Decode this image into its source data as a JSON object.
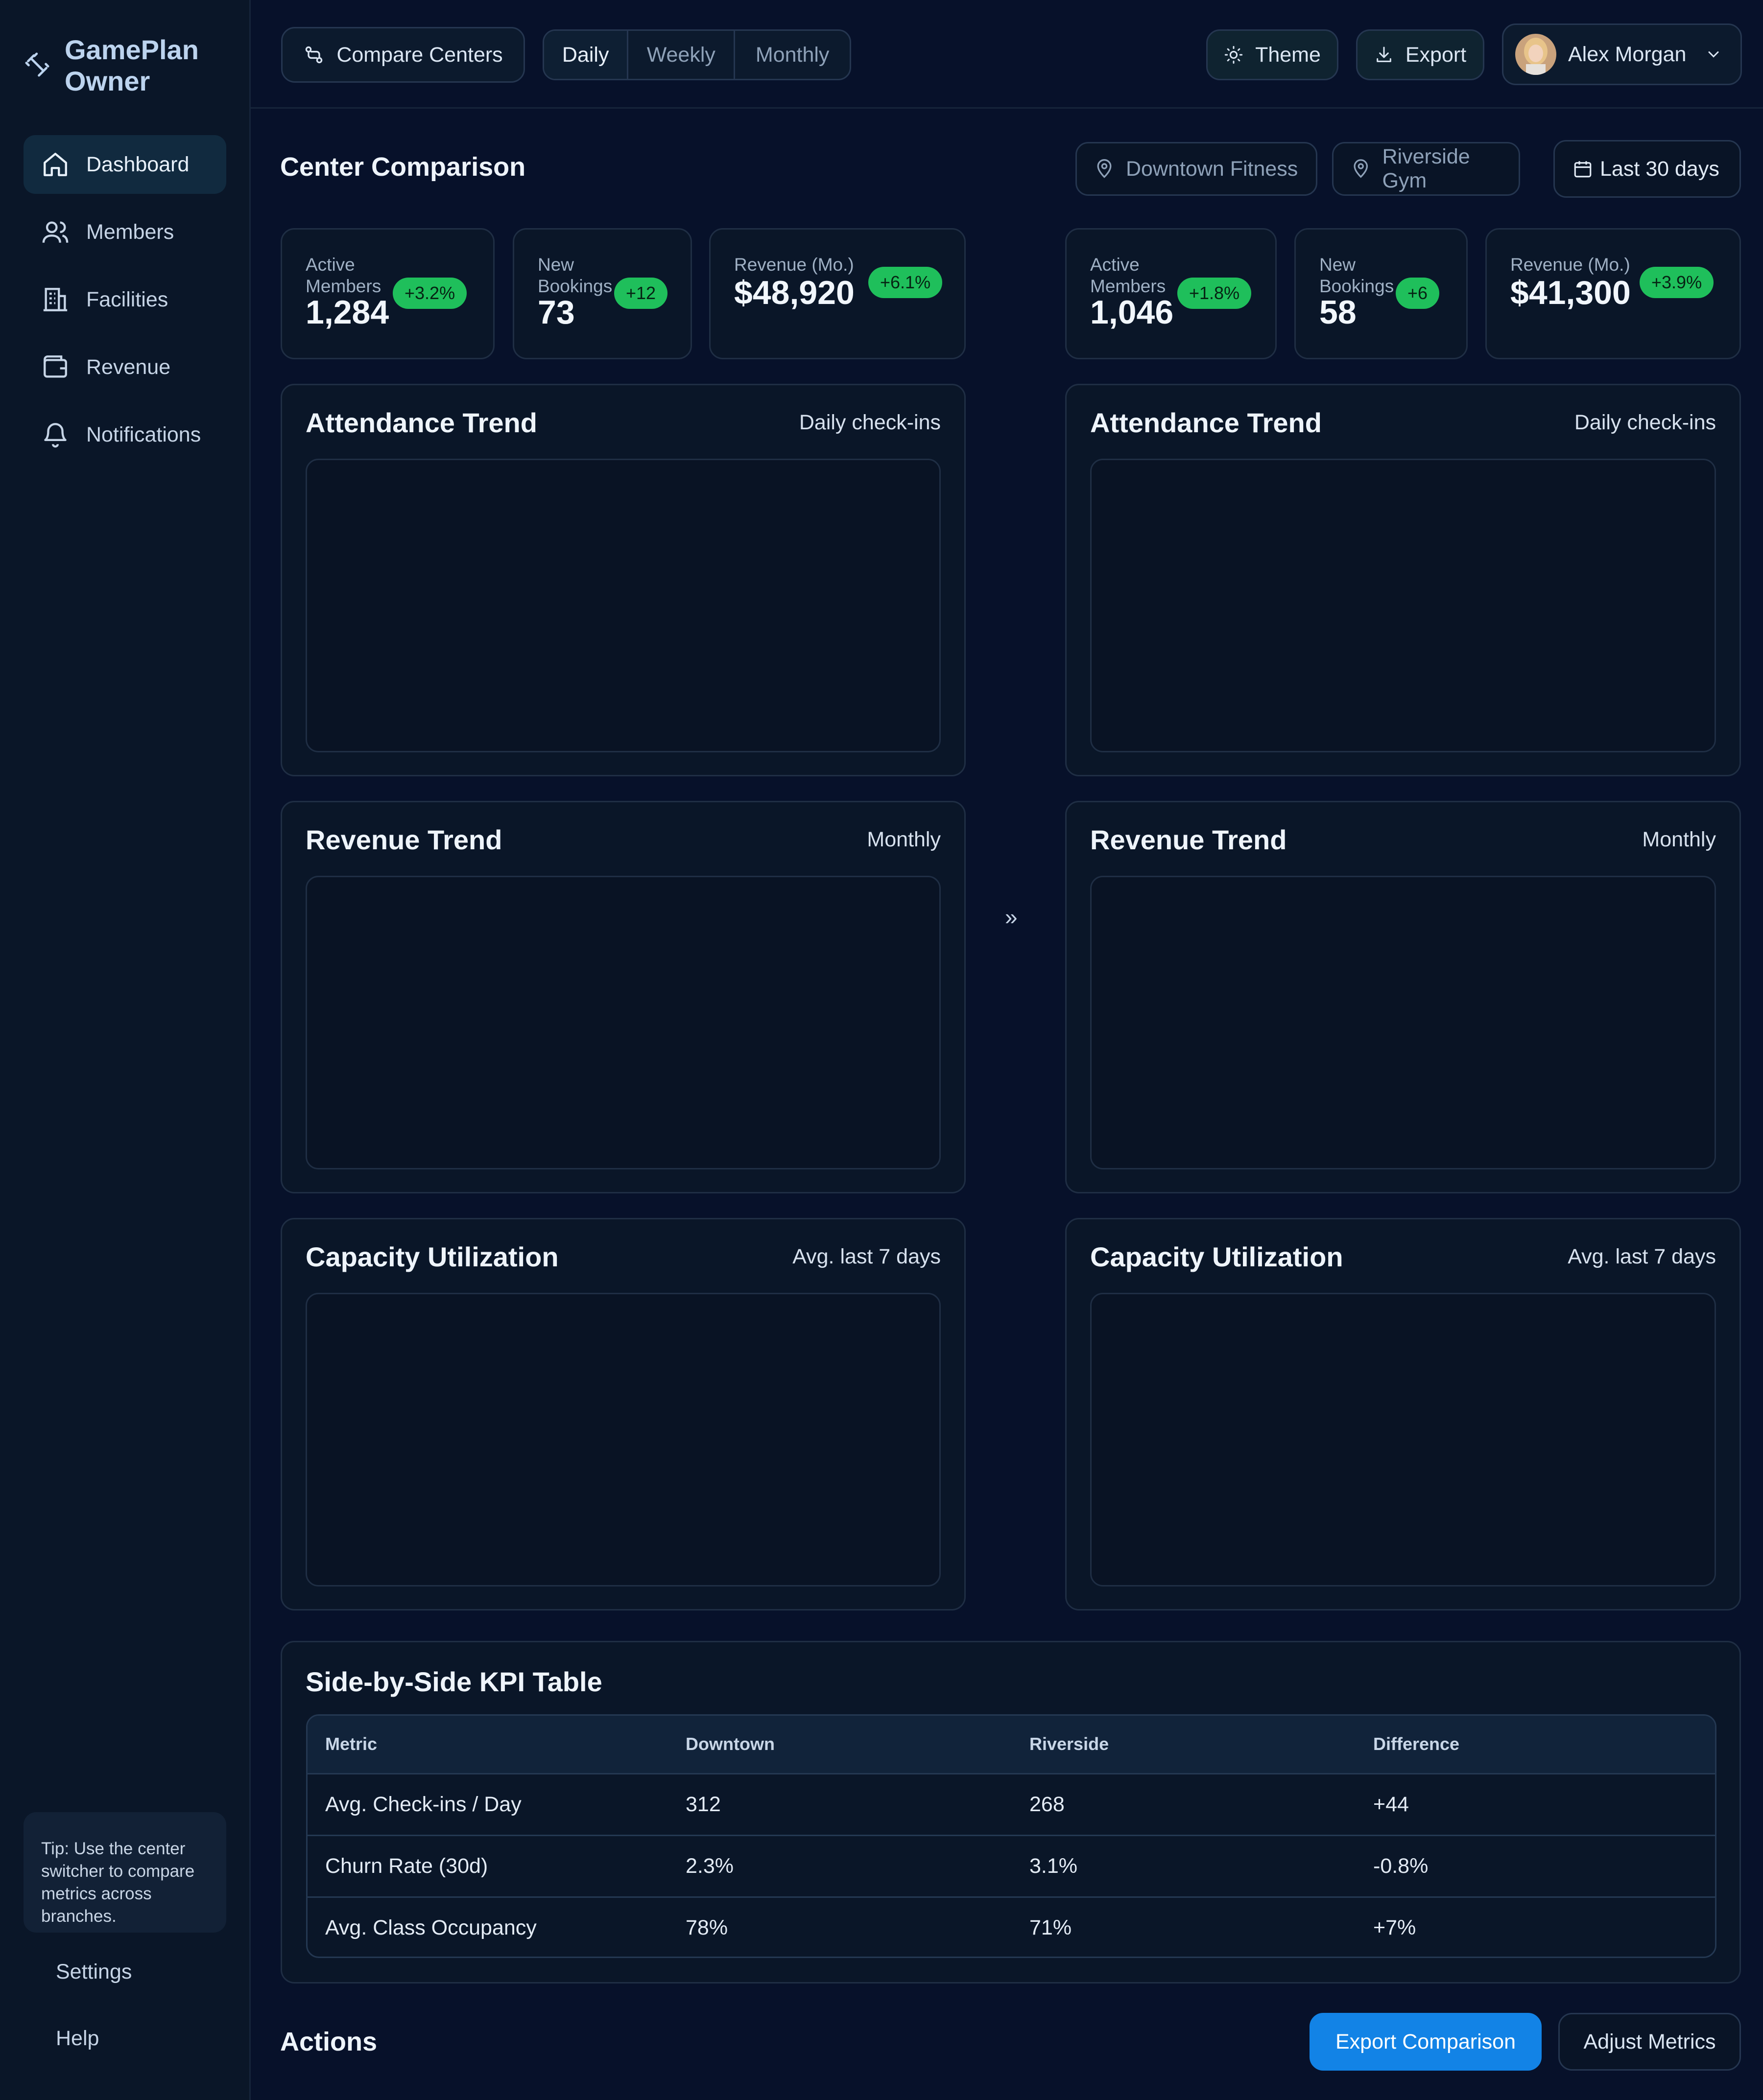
{
  "brand": {
    "line1": "GamePlan",
    "line2": "Owner"
  },
  "nav": [
    {
      "label": "Dashboard",
      "icon": "home-icon",
      "active": true
    },
    {
      "label": "Members",
      "icon": "users-icon"
    },
    {
      "label": "Facilities",
      "icon": "building-icon"
    },
    {
      "label": "Revenue",
      "icon": "wallet-icon"
    },
    {
      "label": "Notifications",
      "icon": "bell-icon"
    }
  ],
  "sidebar": {
    "tip": "Tip: Use the center switcher to compare metrics across branches.",
    "settings": "Settings",
    "help": "Help"
  },
  "topbar": {
    "compare": "Compare Centers",
    "periods": [
      "Daily",
      "Weekly",
      "Monthly"
    ],
    "active_period": "Daily",
    "theme": "Theme",
    "export": "Export",
    "user": "Alex Morgan"
  },
  "page": {
    "title": "Center Comparison",
    "center_a": "Downtown Fitness",
    "center_b": "Riverside Gym",
    "range": "Last 30 days"
  },
  "centers": [
    {
      "kpis": [
        {
          "label_1": "Active",
          "label_2": "Members",
          "value": "1,284",
          "delta": "+3.2%"
        },
        {
          "label_1": "New",
          "label_2": "Bookings",
          "value": "73",
          "delta": "+12"
        },
        {
          "label_1": "Revenue (Mo.)",
          "value": "$48,920",
          "delta": "+6.1%"
        }
      ]
    },
    {
      "kpis": [
        {
          "label_1": "Active",
          "label_2": "Members",
          "value": "1,046",
          "delta": "+1.8%"
        },
        {
          "label_1": "New",
          "label_2": "Bookings",
          "value": "58",
          "delta": "+6"
        },
        {
          "label_1": "Revenue (Mo.)",
          "value": "$41,300",
          "delta": "+3.9%"
        }
      ]
    }
  ],
  "panels": [
    {
      "title": "Attendance Trend",
      "sub": "Daily check-ins"
    },
    {
      "title": "Revenue Trend",
      "sub": "Monthly"
    },
    {
      "title": "Capacity Utilization",
      "sub": "Avg. last 7 days"
    }
  ],
  "swap_glyph": "»",
  "kpi_table": {
    "title": "Side-by-Side KPI Table",
    "headers": [
      "Metric",
      "Downtown",
      "Riverside",
      "Difference"
    ],
    "rows": [
      [
        "Avg. Check-ins / Day",
        "312",
        "268",
        "+44"
      ],
      [
        "Churn Rate (30d)",
        "2.3%",
        "3.1%",
        "-0.8%"
      ],
      [
        "Avg. Class Occupancy",
        "78%",
        "71%",
        "+7%"
      ]
    ]
  },
  "actions": {
    "title": "Actions",
    "export": "Export Comparison",
    "adjust": "Adjust Metrics"
  },
  "colors": {
    "accent": "#1283e6",
    "positive": "#1fbf5b",
    "background": "#07112a",
    "panel": "#0a1628"
  }
}
